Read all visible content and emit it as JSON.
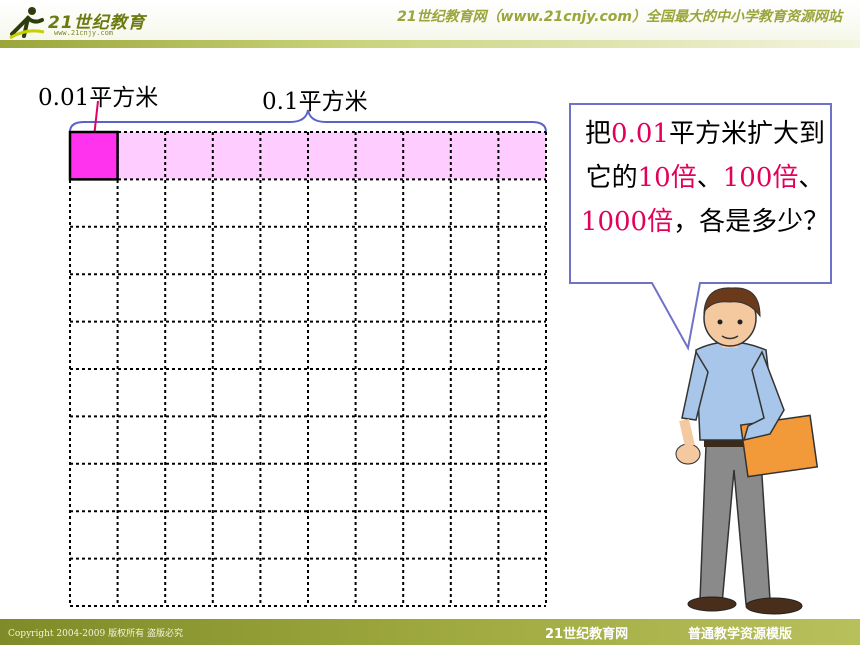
{
  "header": {
    "logo_text": "21世纪教育",
    "logo_url": "www.21cnjy.com",
    "slogan": "21世纪教育网（www.21cnjy.com）全国最大的中小学教育资源网站"
  },
  "footer": {
    "copyright": "Copyright 2004-2009 版权所有 盗版必究",
    "brand": "21世纪教育网",
    "version": "普通教学资源模版"
  },
  "labels": {
    "hundredth": "0.01平方米",
    "tenth": "0.1平方米"
  },
  "grid": {
    "rows": 10,
    "cols": 10,
    "highlighted_row_cols": 10,
    "dark_cell_count": 1
  },
  "bubble": {
    "t1": "把",
    "h1": "0.01",
    "t2": "平方米扩大到它的",
    "h2": "10倍",
    "t3": "、",
    "h3": "100倍",
    "t4": "、",
    "h4": "1000倍",
    "t5": "，各是多少？"
  },
  "colors": {
    "dark_cell": "#ff33ee",
    "light_cell": "#ffccff",
    "highlight_text": "#e2005a",
    "bubble_border": "#6e72c8"
  }
}
